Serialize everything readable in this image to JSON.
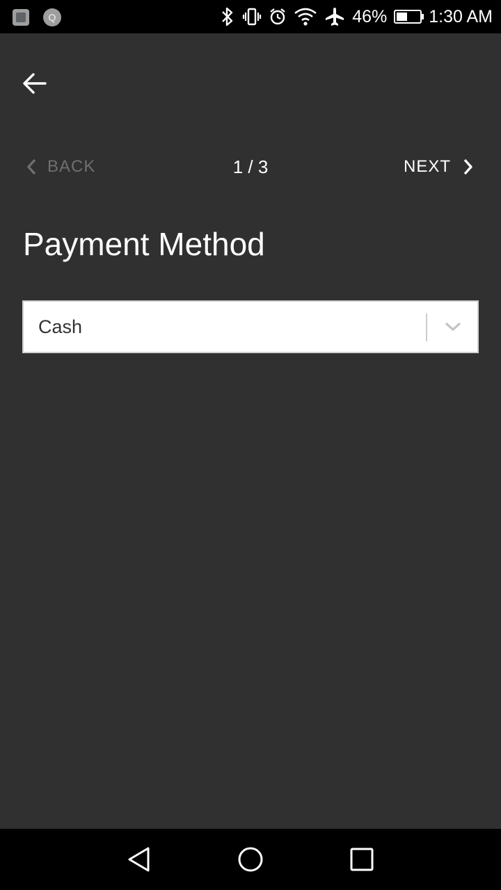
{
  "status_bar": {
    "notification_q_label": "Q",
    "battery_percent": "46%",
    "battery_level": 0.46,
    "time": "1:30 AM",
    "icons": [
      "gallery-icon",
      "q-icon",
      "bluetooth-icon",
      "vibrate-icon",
      "alarm-icon",
      "wifi-icon",
      "airplane-icon",
      "battery-icon"
    ]
  },
  "app_bar": {
    "back_icon": "arrow-left-icon"
  },
  "stepper": {
    "back_label": "BACK",
    "counter": "1 / 3",
    "next_label": "NEXT",
    "back_color": "#6f6f6f",
    "next_color": "#ffffff"
  },
  "page": {
    "title": "Payment Method"
  },
  "payment_select": {
    "value": "Cash"
  },
  "nav_bar": {
    "icons": [
      "nav-back-icon",
      "nav-home-icon",
      "nav-recents-icon"
    ]
  },
  "colors": {
    "background": "#303030",
    "status_bar": "#000000",
    "nav_bar": "#000000",
    "select_background": "#ffffff"
  }
}
